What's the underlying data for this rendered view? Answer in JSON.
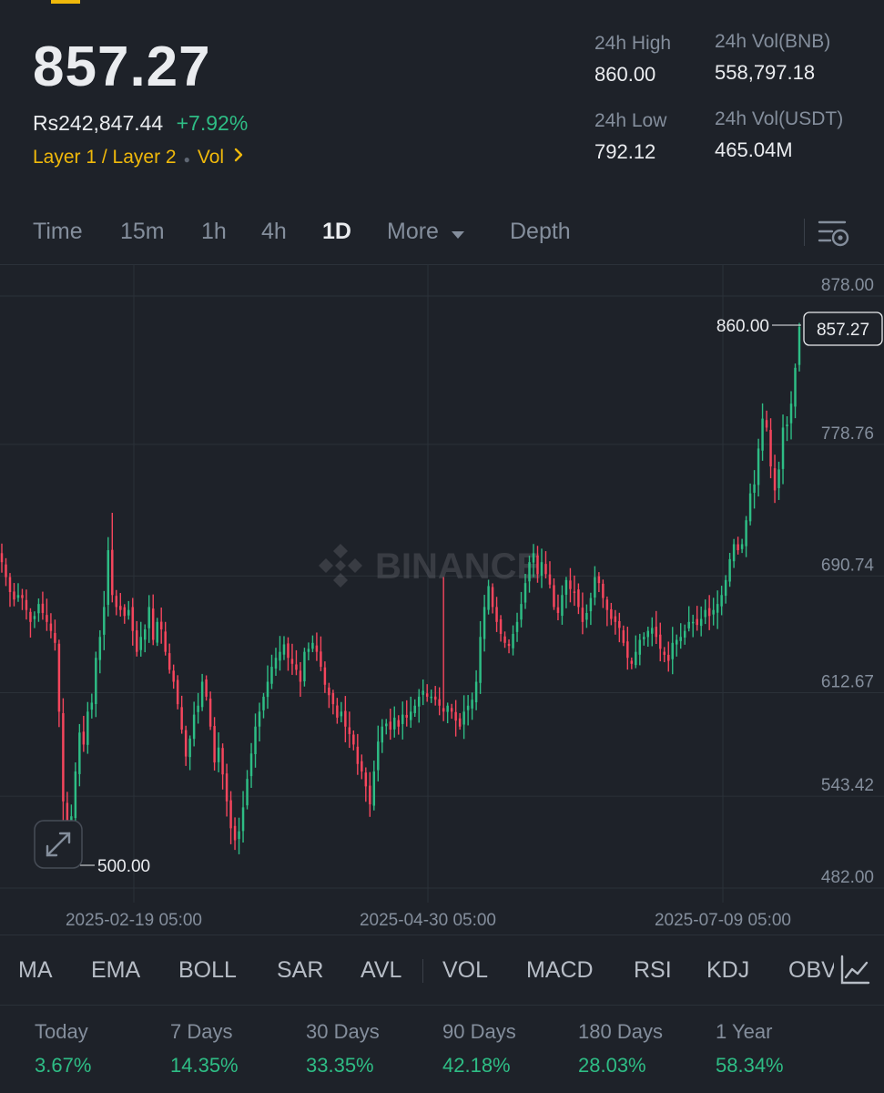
{
  "ticker": {
    "last_price": "857.27",
    "fiat_price": "Rs242,847.44",
    "change_pct": "+7.92%",
    "tag_layer": "Layer 1 / Layer 2",
    "tag_vol": "Vol",
    "stats": {
      "high_label": "24h High",
      "high_value": "860.00",
      "low_label": "24h Low",
      "low_value": "792.12",
      "vol_bnb_label": "24h Vol(BNB)",
      "vol_bnb_value": "558,797.18",
      "vol_usdt_label": "24h Vol(USDT)",
      "vol_usdt_value": "465.04M"
    }
  },
  "timeframes": {
    "time": "Time",
    "m15": "15m",
    "h1": "1h",
    "h4": "4h",
    "d1": "1D",
    "more": "More",
    "depth": "Depth"
  },
  "chart": {
    "watermark": "BINANCE",
    "max_marker": "860.00",
    "min_marker": "500.00",
    "current_tag": "857.27",
    "y_ticks": [
      "878.00",
      "778.76",
      "690.74",
      "612.67",
      "543.42",
      "482.00"
    ],
    "x_ticks": [
      "2025-02-19 05:00",
      "2025-04-30 05:00",
      "2025-07-09 05:00"
    ]
  },
  "chart_data": {
    "type": "candlestick",
    "ylim": [
      482,
      878
    ],
    "y_ticks": [
      878.0,
      778.76,
      690.74,
      612.67,
      543.42,
      482.0
    ],
    "x_ticks": [
      "2025-02-19 05:00",
      "2025-04-30 05:00",
      "2025-07-09 05:00"
    ],
    "interval": "1D",
    "high_marker": 860.0,
    "low_marker": 500.0,
    "last": 857.27,
    "up_color": "#2ebd85",
    "down_color": "#f6465d",
    "close": [
      700,
      690,
      680,
      675,
      678,
      676,
      668,
      660,
      664,
      672,
      666,
      660,
      654,
      646,
      600,
      540,
      510,
      530,
      560,
      586,
      578,
      600,
      606,
      636,
      650,
      670,
      708,
      678,
      670,
      668,
      664,
      668,
      654,
      640,
      650,
      655,
      670,
      648,
      660,
      655,
      640,
      628,
      620,
      605,
      588,
      570,
      582,
      598,
      604,
      620,
      610,
      590,
      566,
      576,
      558,
      540,
      522,
      514,
      520,
      536,
      555,
      572,
      590,
      600,
      610,
      620,
      630,
      636,
      640,
      645,
      636,
      632,
      628,
      620,
      640,
      642,
      646,
      640,
      630,
      618,
      611,
      605,
      596,
      600,
      590,
      585,
      578,
      565,
      560,
      550,
      538,
      560,
      580,
      590,
      592,
      588,
      596,
      590,
      598,
      596,
      600,
      604,
      610,
      614,
      610,
      610,
      608,
      604,
      600,
      604,
      600,
      594,
      590,
      600,
      604,
      608,
      620,
      650,
      670,
      684,
      670,
      660,
      652,
      646,
      644,
      652,
      660,
      672,
      686,
      700,
      706,
      692,
      700,
      692,
      685,
      670,
      666,
      678,
      688,
      682,
      680,
      670,
      660,
      666,
      676,
      690,
      686,
      676,
      668,
      662,
      660,
      656,
      646,
      636,
      632,
      640,
      648,
      650,
      654,
      656,
      650,
      642,
      638,
      634,
      646,
      648,
      650,
      654,
      660,
      660,
      658,
      662,
      668,
      664,
      668,
      672,
      678,
      688,
      702,
      712,
      708,
      712,
      728,
      746,
      752,
      776,
      796,
      790,
      764,
      748,
      762,
      790,
      792,
      806,
      830,
      857.27
    ]
  },
  "indicators": [
    "MA",
    "EMA",
    "BOLL",
    "SAR",
    "AVL",
    "VOL",
    "MACD",
    "RSI",
    "KDJ",
    "OBV"
  ],
  "performance": [
    {
      "label": "Today",
      "value": "3.67%"
    },
    {
      "label": "7 Days",
      "value": "14.35%"
    },
    {
      "label": "30 Days",
      "value": "33.35%"
    },
    {
      "label": "90 Days",
      "value": "42.18%"
    },
    {
      "label": "180 Days",
      "value": "28.03%"
    },
    {
      "label": "1 Year",
      "value": "58.34%"
    }
  ]
}
